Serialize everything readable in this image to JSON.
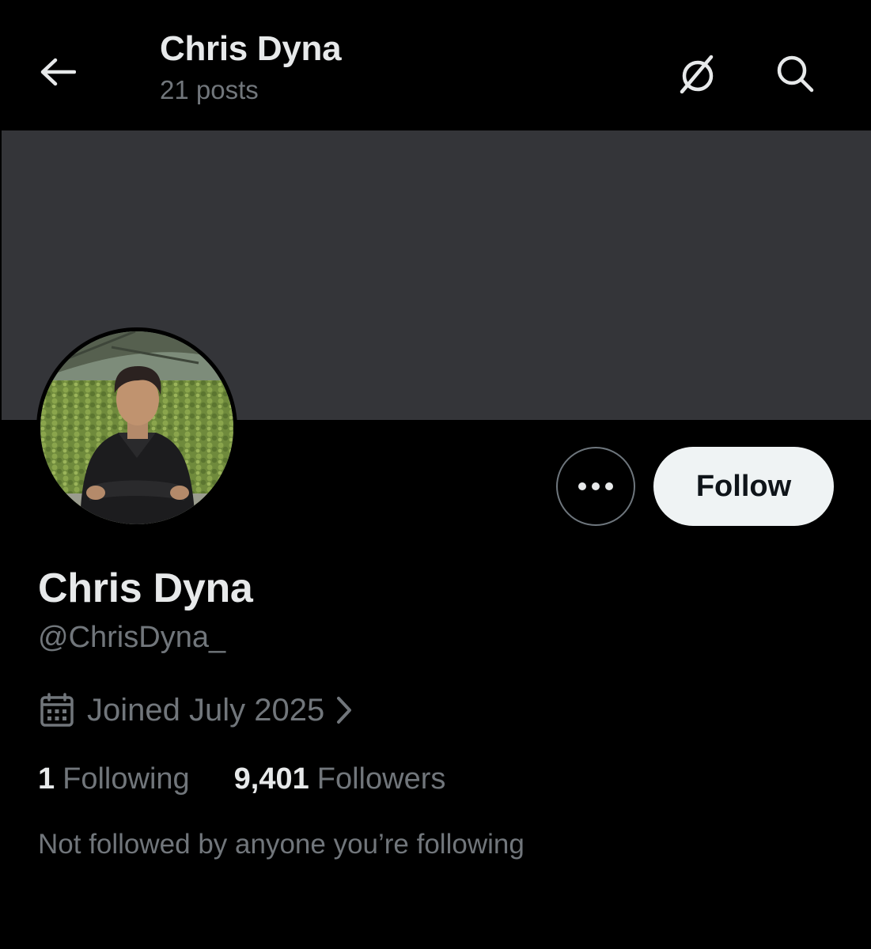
{
  "header": {
    "title": "Chris Dyna",
    "posts_count": "21 posts",
    "back_icon": "arrow-left-icon",
    "grok_icon": "grok-icon",
    "search_icon": "search-icon"
  },
  "profile": {
    "display_name": "Chris Dyna",
    "handle": "@ChrisDyna_",
    "joined": "Joined July 2025",
    "following_count": "1",
    "following_label": "Following",
    "followers_count": "9,401",
    "followers_label": "Followers",
    "mutuals_note": "Not followed by anyone you’re following"
  },
  "actions": {
    "more_icon": "more-horizontal-icon",
    "follow_label": "Follow"
  },
  "colors": {
    "background": "#000000",
    "banner": "#343539",
    "primary_text": "#e7e9ea",
    "secondary_text": "#71767b",
    "follow_button_bg": "#eff3f4",
    "follow_button_text": "#0f1419"
  }
}
